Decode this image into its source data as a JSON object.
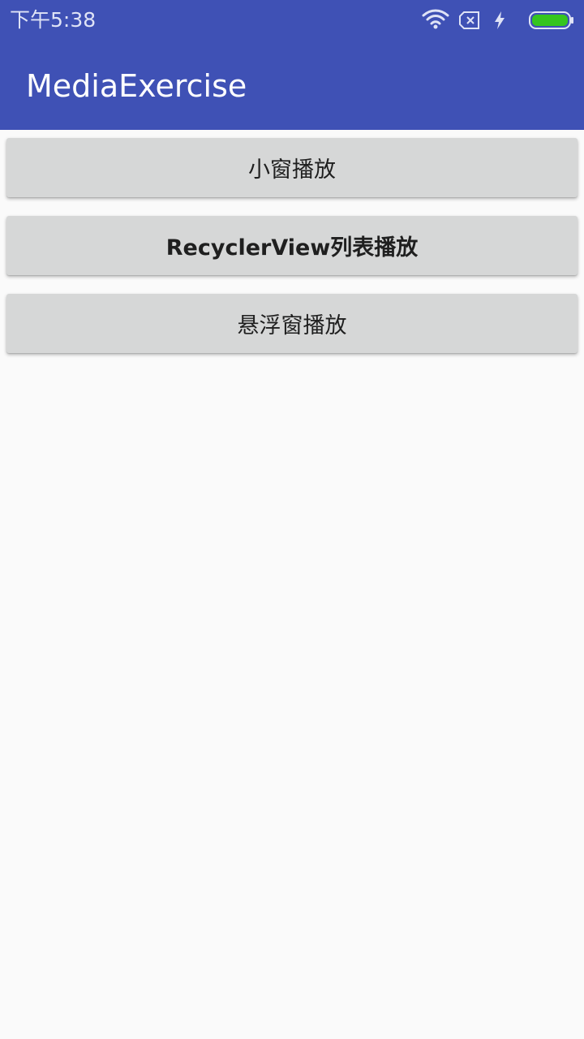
{
  "status_bar": {
    "time": "下午5:38",
    "icons": [
      "wifi-icon",
      "no-sim-icon",
      "charging-bolt-icon",
      "battery-icon"
    ],
    "battery_color": "#35c51f",
    "background": "#3f51b5"
  },
  "app_bar": {
    "title": "MediaExercise",
    "background": "#3f51b5"
  },
  "buttons": [
    {
      "label": "小窗播放"
    },
    {
      "label": "RecyclerView列表播放"
    },
    {
      "label": "悬浮窗播放"
    }
  ]
}
